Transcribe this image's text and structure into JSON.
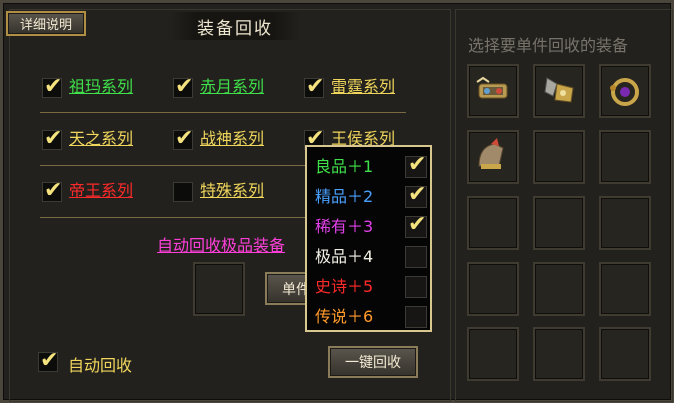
{
  "header": {
    "detail_button": "详细说明",
    "title": "装备回收"
  },
  "series_options": [
    {
      "label": "祖玛系列",
      "checked": true,
      "color": "#3fe04a"
    },
    {
      "label": "赤月系列",
      "checked": true,
      "color": "#3fe04a"
    },
    {
      "label": "雷霆系列",
      "checked": true,
      "color": "#f0d65c"
    },
    {
      "label": "天之系列",
      "checked": true,
      "color": "#f0d65c"
    },
    {
      "label": "战神系列",
      "checked": true,
      "color": "#f0d65c"
    },
    {
      "label": "王侯系列",
      "checked": true,
      "color": "#f0d65c"
    },
    {
      "label": "帝王系列",
      "checked": true,
      "color": "#ff2a2a"
    },
    {
      "label": "特殊系列",
      "checked": false,
      "color": "#f0d65c"
    }
  ],
  "auto_best_label": "自动回收极品装备",
  "single_button_label": "单件",
  "onekey_button_label": "一键回收",
  "auto_recycle": {
    "label": "自动回收",
    "checked": true
  },
  "right_panel": {
    "title": "选择要单件回收的装备",
    "slots": [
      {
        "item": "bracelet-icon"
      },
      {
        "item": "armor-icon"
      },
      {
        "item": "amulet-icon"
      },
      {
        "item": "helmet-icon"
      },
      {
        "item": null
      },
      {
        "item": null
      },
      {
        "item": null
      },
      {
        "item": null
      },
      {
        "item": null
      },
      {
        "item": null
      },
      {
        "item": null
      },
      {
        "item": null
      },
      {
        "item": null
      },
      {
        "item": null
      },
      {
        "item": null
      }
    ]
  },
  "quality_popup": {
    "options": [
      {
        "label": "良品＋1",
        "checked": true,
        "color": "#3fe04a"
      },
      {
        "label": "精品＋2",
        "checked": true,
        "color": "#4aa0ff"
      },
      {
        "label": "稀有＋3",
        "checked": true,
        "color": "#e040e8"
      },
      {
        "label": "极品＋4",
        "checked": false,
        "color": "#f2f0e6"
      },
      {
        "label": "史诗＋5",
        "checked": false,
        "color": "#ff2a2a"
      },
      {
        "label": "传说＋6",
        "checked": false,
        "color": "#ff9a2a"
      }
    ]
  },
  "check_glyph": "✔"
}
